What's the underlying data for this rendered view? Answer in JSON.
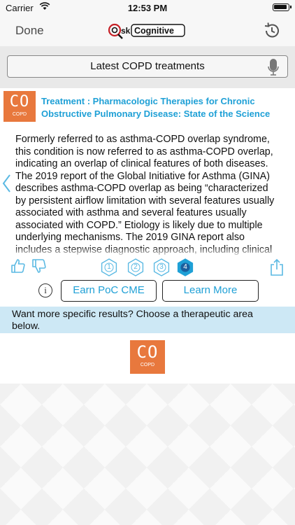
{
  "status_bar": {
    "carrier": "Carrier",
    "time": "12:53 PM"
  },
  "nav": {
    "done_label": "Done",
    "logo_text_ask": "ask",
    "logo_text_cognitive": "Cognitive"
  },
  "search": {
    "query": "Latest COPD treatments"
  },
  "result": {
    "badge_main": "CO",
    "badge_sub": "COPD",
    "title": "Treatment : Pharmacologic Therapies for Chronic Obstructive Pulmonary Disease: State of the Science",
    "body": "Formerly referred to as asthma-COPD overlap syndrome, this condition is now referred to as asthma-COPD overlap, indicating an overlap of clinical features of both diseases. The 2019 report of the Global Initiative for Asthma (GINA) describes asthma-COPD overlap as being “characterized by persistent airflow limitation with several features usually associated with asthma and several features usually associated with COPD.” Etiology is likely due to multiple underlying mechanisms. The 2019 GINA report also includes a stepwise diagnostic approach, including clinical features, spirometric"
  },
  "pagination": {
    "pages": [
      "1",
      "2",
      "3",
      "4"
    ],
    "active": "4"
  },
  "actions": {
    "earn_label": "Earn PoC CME",
    "learn_label": "Learn More",
    "info_glyph": "i"
  },
  "banner": {
    "text": "Want more specific results? Choose a therapeutic area below."
  },
  "area": {
    "badge_main": "CO",
    "badge_sub": "COPD"
  },
  "colors": {
    "accent": "#1fa0d6",
    "badge": "#e8783d",
    "banner": "#cde8f5"
  }
}
